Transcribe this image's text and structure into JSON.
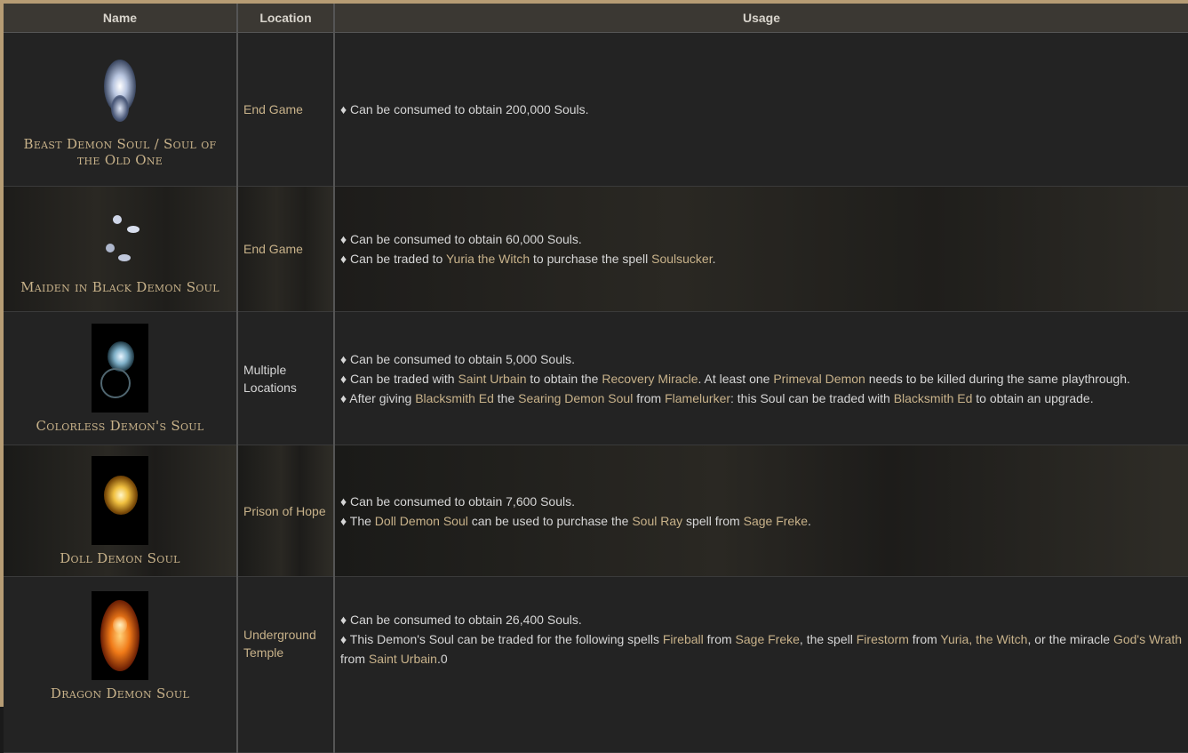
{
  "headers": {
    "name": "Name",
    "location": "Location",
    "usage": "Usage"
  },
  "rows": [
    {
      "name": "Beast Demon Soul / Soul of the Old One",
      "icon": "white-soul-icon",
      "location": "End Game",
      "usage": [
        [
          {
            "t": "♦ Can be consumed to obtain 200,000 Souls."
          }
        ]
      ]
    },
    {
      "name": "Maiden in Black Demon Soul",
      "icon": "crescent-soul-icon",
      "location": "End Game",
      "usage": [
        [
          {
            "t": "♦ Can be consumed to obtain 60,000 Souls."
          }
        ],
        [
          {
            "t": "♦ Can be traded to "
          },
          {
            "t": "Yuria the Witch",
            "l": true
          },
          {
            "t": " to purchase the spell "
          },
          {
            "t": "Soulsucker",
            "l": true
          },
          {
            "t": "."
          }
        ]
      ]
    },
    {
      "name": "Colorless Demon's Soul",
      "icon": "colorless-soul-icon",
      "location": "Multiple Locations",
      "usage": [
        [
          {
            "t": "♦ Can be consumed to obtain 5,000 Souls."
          }
        ],
        [
          {
            "t": "♦ Can be traded with "
          },
          {
            "t": "Saint Urbain",
            "l": true
          },
          {
            "t": " to obtain the "
          },
          {
            "t": "Recovery Miracle",
            "l": true
          },
          {
            "t": ". At least one "
          },
          {
            "t": "Primeval Demon",
            "l": true
          },
          {
            "t": " needs to be killed during the same playthrough."
          }
        ],
        [
          {
            "t": "♦ After giving "
          },
          {
            "t": "Blacksmith Ed",
            "l": true
          },
          {
            "t": " the "
          },
          {
            "t": "Searing Demon Soul",
            "l": true
          },
          {
            "t": " from "
          },
          {
            "t": "Flamelurker",
            "l": true
          },
          {
            "t": ": this Soul can be traded with "
          },
          {
            "t": "Blacksmith Ed",
            "l": true
          },
          {
            "t": " to obtain an upgrade."
          }
        ]
      ]
    },
    {
      "name": "Doll Demon Soul",
      "icon": "golden-soul-icon",
      "location": "Prison of Hope",
      "usage": [
        [
          {
            "t": "♦ Can be consumed to obtain 7,600 Souls."
          }
        ],
        [
          {
            "t": "♦ The "
          },
          {
            "t": "Doll Demon Soul",
            "l": true
          },
          {
            "t": " can be used to purchase the "
          },
          {
            "t": "Soul Ray",
            "l": true
          },
          {
            "t": " spell from "
          },
          {
            "t": "Sage Freke",
            "l": true
          },
          {
            "t": "."
          }
        ]
      ]
    },
    {
      "name": "Dragon Demon Soul",
      "icon": "fire-soul-icon",
      "location": "Underground Temple",
      "usage": [
        [
          {
            "t": "♦ Can be consumed to obtain 26,400 Souls."
          }
        ],
        [
          {
            "t": "♦ This Demon's Soul can be traded for the following spells "
          },
          {
            "t": "Fireball",
            "l": true
          },
          {
            "t": " from "
          },
          {
            "t": "Sage Freke",
            "l": true
          },
          {
            "t": ", the spell "
          },
          {
            "t": "Firestorm",
            "l": true
          },
          {
            "t": " from "
          },
          {
            "t": "Yuria, the Witch",
            "l": true
          },
          {
            "t": ", or the miracle "
          },
          {
            "t": "God's Wrath",
            "l": true
          }
        ],
        [
          {
            "t": " from "
          },
          {
            "t": "Saint Urbain",
            "l": true
          },
          {
            "t": ".0"
          }
        ]
      ]
    }
  ],
  "colors": {
    "accent": "#c8b28a",
    "header_bg": "#3b3833",
    "frame": "#b69c74"
  }
}
